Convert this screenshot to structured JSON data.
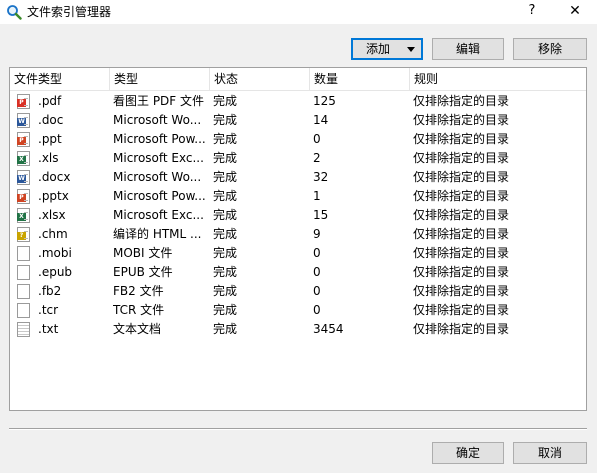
{
  "window": {
    "title": "文件索引管理器",
    "help_glyph": "?",
    "close_glyph": "✕"
  },
  "toolbar": {
    "add_label": "添加",
    "edit_label": "编辑",
    "remove_label": "移除"
  },
  "table": {
    "headers": [
      "文件类型",
      "类型",
      "状态",
      "数量",
      "规则"
    ],
    "rows": [
      {
        "ext": ".pdf",
        "type": "看图王 PDF 文件",
        "status": "完成",
        "count": "125",
        "rule": "仅排除指定的目录",
        "icon": "pdf-icon",
        "color": "#d93025",
        "badge": "P"
      },
      {
        "ext": ".doc",
        "type": "Microsoft Wo...",
        "status": "完成",
        "count": "14",
        "rule": "仅排除指定的目录",
        "icon": "word-icon",
        "color": "#2b579a",
        "badge": "W"
      },
      {
        "ext": ".ppt",
        "type": "Microsoft Pow...",
        "status": "完成",
        "count": "0",
        "rule": "仅排除指定的目录",
        "icon": "powerpoint-icon",
        "color": "#d04423",
        "badge": "P"
      },
      {
        "ext": ".xls",
        "type": "Microsoft Exc...",
        "status": "完成",
        "count": "2",
        "rule": "仅排除指定的目录",
        "icon": "excel-icon",
        "color": "#217346",
        "badge": "X"
      },
      {
        "ext": ".docx",
        "type": "Microsoft Wo...",
        "status": "完成",
        "count": "32",
        "rule": "仅排除指定的目录",
        "icon": "word-icon",
        "color": "#2b579a",
        "badge": "W"
      },
      {
        "ext": ".pptx",
        "type": "Microsoft Pow...",
        "status": "完成",
        "count": "1",
        "rule": "仅排除指定的目录",
        "icon": "powerpoint-icon",
        "color": "#d04423",
        "badge": "P"
      },
      {
        "ext": ".xlsx",
        "type": "Microsoft Exc...",
        "status": "完成",
        "count": "15",
        "rule": "仅排除指定的目录",
        "icon": "excel-icon",
        "color": "#217346",
        "badge": "X"
      },
      {
        "ext": ".chm",
        "type": "编译的 HTML ...",
        "status": "完成",
        "count": "9",
        "rule": "仅排除指定的目录",
        "icon": "help-file-icon",
        "color": "#c9a400",
        "badge": "?"
      },
      {
        "ext": ".mobi",
        "type": "MOBI 文件",
        "status": "完成",
        "count": "0",
        "rule": "仅排除指定的目录",
        "icon": "blank-file-icon",
        "color": "",
        "badge": ""
      },
      {
        "ext": ".epub",
        "type": "EPUB 文件",
        "status": "完成",
        "count": "0",
        "rule": "仅排除指定的目录",
        "icon": "blank-file-icon",
        "color": "",
        "badge": ""
      },
      {
        "ext": ".fb2",
        "type": "FB2 文件",
        "status": "完成",
        "count": "0",
        "rule": "仅排除指定的目录",
        "icon": "blank-file-icon",
        "color": "",
        "badge": ""
      },
      {
        "ext": ".tcr",
        "type": "TCR 文件",
        "status": "完成",
        "count": "0",
        "rule": "仅排除指定的目录",
        "icon": "blank-file-icon",
        "color": "",
        "badge": ""
      },
      {
        "ext": ".txt",
        "type": "文本文档",
        "status": "完成",
        "count": "3454",
        "rule": "仅排除指定的目录",
        "icon": "text-file-icon",
        "color": "",
        "badge": ""
      }
    ]
  },
  "footer": {
    "ok_label": "确定",
    "cancel_label": "取消"
  }
}
